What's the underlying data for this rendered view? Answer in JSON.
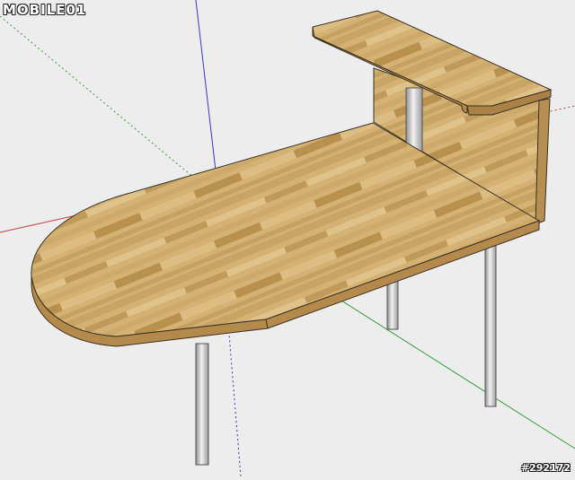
{
  "watermark": {
    "brand": "MOBILE01"
  },
  "photo_id": "#292172",
  "colors": {
    "background": "#ededed",
    "axis_red": "#c43b3b",
    "axis_green": "#35a335",
    "axis_blue": "#3535c8",
    "wood_light": "#d2b070",
    "wood_dark": "#b89050",
    "metal": "#c8c8c8",
    "edge": "#3a3020"
  }
}
